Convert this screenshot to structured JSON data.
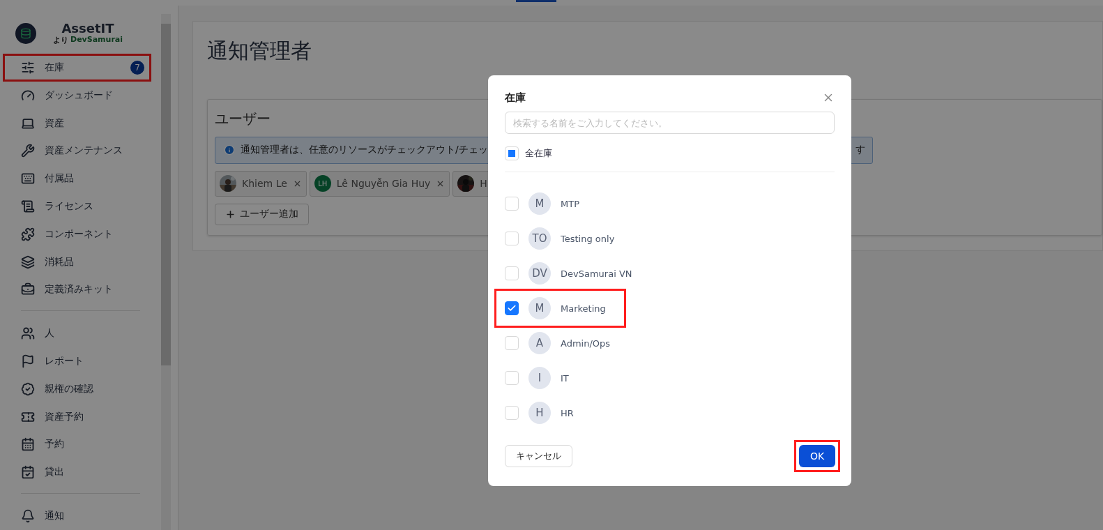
{
  "sidebar": {
    "logo": {
      "name": "AssetIT",
      "by": "より",
      "company": "DevSamurai"
    },
    "sections": [
      [
        {
          "label": "在庫",
          "badge": "7",
          "annotated": true
        },
        {
          "label": "ダッシュボード",
          "annotated": false
        },
        {
          "label": "資産",
          "annotated": false
        },
        {
          "label": "資産メンテナンス",
          "annotated": false
        },
        {
          "label": "付属品",
          "annotated": false
        },
        {
          "label": "ライセンス",
          "annotated": false
        },
        {
          "label": "コンポーネント",
          "annotated": false
        },
        {
          "label": "消耗品",
          "annotated": false
        },
        {
          "label": "定義済みキット",
          "annotated": false
        }
      ],
      [
        {
          "label": "人",
          "annotated": false
        },
        {
          "label": "レポート",
          "annotated": false
        },
        {
          "label": "親権の確認",
          "annotated": false
        },
        {
          "label": "資産予約",
          "annotated": false
        },
        {
          "label": "予約",
          "annotated": false
        },
        {
          "label": "貸出",
          "annotated": false
        }
      ],
      [
        {
          "label": "通知",
          "annotated": false
        }
      ]
    ]
  },
  "page": {
    "title": "通知管理者",
    "users_card": {
      "title": "ユーザー",
      "info_before": "通知管理者は、任意のリソースがチェックアウト/チェッ",
      "info_after": "す",
      "users": [
        {
          "name": "Khiem Le",
          "kind": "picture",
          "removable": true
        },
        {
          "name": "Lê Nguyễn Gia Huy",
          "kind": "initials",
          "initials": "LH",
          "removable": true
        },
        {
          "name": "H",
          "kind": "picture",
          "removable": false
        }
      ],
      "add_button": "ユーザー追加"
    }
  },
  "dialog": {
    "title": "在庫",
    "search": {
      "placeholder": "検索する名前をご入力してください。"
    },
    "all_option": {
      "label": "全在庫",
      "indeterminate": true
    },
    "items": [
      {
        "initials": "M",
        "name": "MTP",
        "checked": false,
        "annotated": false
      },
      {
        "initials": "TO",
        "name": "Testing only",
        "checked": false,
        "annotated": false
      },
      {
        "initials": "DV",
        "name": "DevSamurai VN",
        "checked": false,
        "annotated": false
      },
      {
        "initials": "M",
        "name": "Marketing",
        "checked": true,
        "annotated": true
      },
      {
        "initials": "A",
        "name": "Admin/Ops",
        "checked": false,
        "annotated": false
      },
      {
        "initials": "I",
        "name": "IT",
        "checked": false,
        "annotated": false
      },
      {
        "initials": "H",
        "name": "HR",
        "checked": false,
        "annotated": false
      }
    ],
    "cancel": "キャンセル",
    "ok": {
      "label": "OK",
      "annotated": true
    }
  }
}
